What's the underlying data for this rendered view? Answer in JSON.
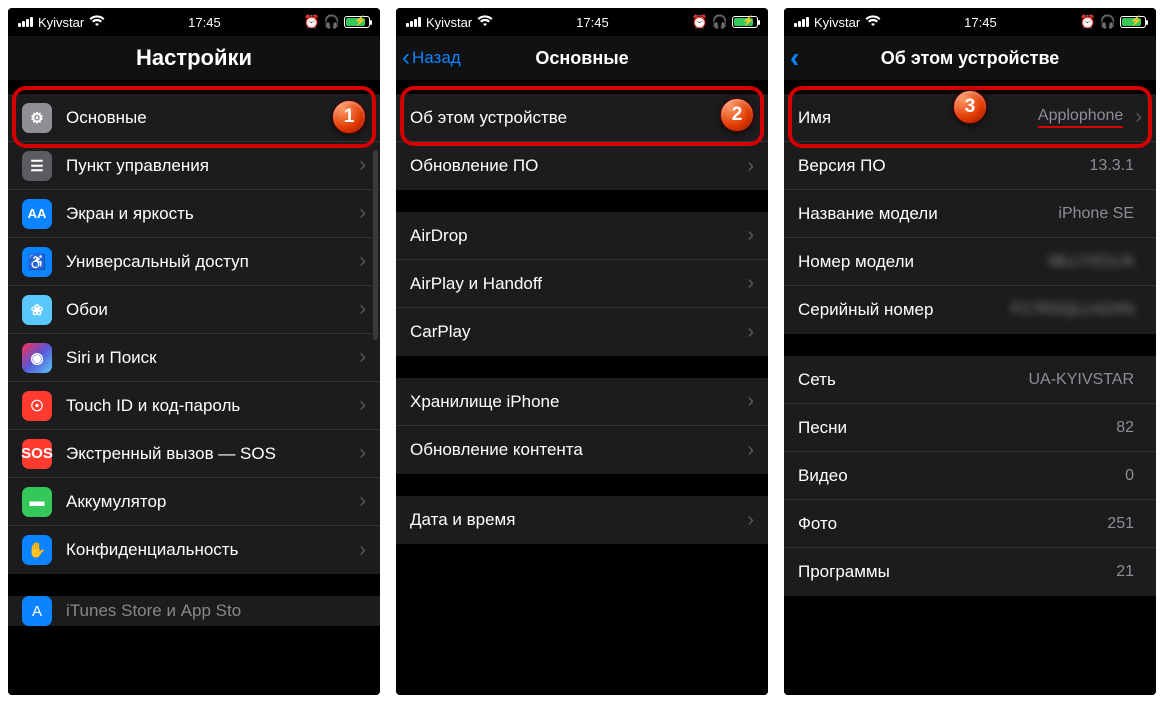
{
  "status": {
    "carrier": "Kyivstar",
    "time": "17:45"
  },
  "screen1": {
    "title": "Настройки",
    "rows": [
      {
        "label": "Основные",
        "icon": "gear",
        "color": "ic-grey",
        "glyph": "⚙"
      },
      {
        "label": "Пункт управления",
        "icon": "switches",
        "color": "ic-darkgrey",
        "glyph": "☰"
      },
      {
        "label": "Экран и яркость",
        "icon": "display",
        "color": "ic-blue",
        "glyph": "AA"
      },
      {
        "label": "Универсальный доступ",
        "icon": "accessibility",
        "color": "ic-blue",
        "glyph": "♿"
      },
      {
        "label": "Обои",
        "icon": "wallpaper",
        "color": "ic-cyan",
        "glyph": "❀"
      },
      {
        "label": "Siri и Поиск",
        "icon": "siri",
        "color": "ic-siri",
        "glyph": "◉"
      },
      {
        "label": "Touch ID и код-пароль",
        "icon": "touchid",
        "color": "ic-red",
        "glyph": "☉"
      },
      {
        "label": "Экстренный вызов — SOS",
        "icon": "sos",
        "color": "ic-sos",
        "glyph": "SOS"
      },
      {
        "label": "Аккумулятор",
        "icon": "battery",
        "color": "ic-green",
        "glyph": "▬"
      },
      {
        "label": "Конфиденциальность",
        "icon": "privacy",
        "color": "ic-hand",
        "glyph": "✋"
      }
    ],
    "cut_row_label": "iTunes Store и App Sto"
  },
  "screen2": {
    "back": "Назад",
    "title": "Основные",
    "groups": [
      [
        {
          "label": "Об этом устройстве"
        },
        {
          "label": "Обновление ПО"
        }
      ],
      [
        {
          "label": "AirDrop"
        },
        {
          "label": "AirPlay и Handoff"
        },
        {
          "label": "CarPlay"
        }
      ],
      [
        {
          "label": "Хранилище iPhone"
        },
        {
          "label": "Обновление контента"
        }
      ],
      [
        {
          "label": "Дата и время"
        }
      ]
    ]
  },
  "screen3": {
    "title": "Об этом устройстве",
    "groups": [
      [
        {
          "label": "Имя",
          "value": "Applophone",
          "chev": true
        },
        {
          "label": "Версия ПО",
          "value": "13.3.1"
        },
        {
          "label": "Название модели",
          "value": "iPhone SE"
        },
        {
          "label": "Номер модели",
          "value": "MLLY2CL/A",
          "blur": true
        },
        {
          "label": "Серийный номер",
          "value": "F17RSQLLH2XN",
          "blur": true
        }
      ],
      [
        {
          "label": "Сеть",
          "value": "UA-KYIVSTAR"
        },
        {
          "label": "Песни",
          "value": "82"
        },
        {
          "label": "Видео",
          "value": "0"
        },
        {
          "label": "Фото",
          "value": "251"
        },
        {
          "label": "Программы",
          "value": "21"
        }
      ]
    ]
  },
  "badges": {
    "b1": "1",
    "b2": "2",
    "b3": "3"
  }
}
